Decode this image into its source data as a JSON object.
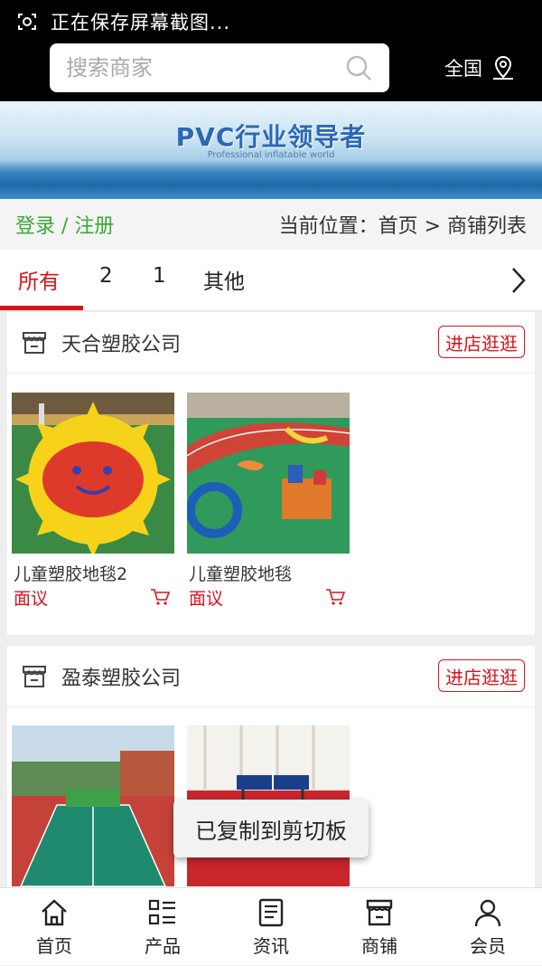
{
  "status_bar": {
    "message": "正在保存屏幕截图..."
  },
  "header": {
    "search": {
      "placeholder": "搜索商家",
      "value": ""
    },
    "region_label": "全国"
  },
  "banner": {
    "title": "PVC行业领导者",
    "subtitle": "Professional inflatable world"
  },
  "breadcrumb": {
    "login_label": "登录 / 注册",
    "position_label": "当前位置：首页 > 商铺列表"
  },
  "tabs": [
    {
      "label": "所有",
      "active": true
    },
    {
      "label": "2",
      "active": false
    },
    {
      "label": "1",
      "active": false
    },
    {
      "label": "其他",
      "active": false
    }
  ],
  "shops": [
    {
      "name": "天合塑胶公司",
      "visit_label": "进店逛逛",
      "products": [
        {
          "name": "儿童塑胶地毯2",
          "price": "面议"
        },
        {
          "name": "儿童塑胶地毯",
          "price": "面议"
        }
      ]
    },
    {
      "name": "盈泰塑胶公司",
      "visit_label": "进店逛逛",
      "products": []
    }
  ],
  "toast": {
    "message": "已复制到剪切板"
  },
  "bottom_nav": [
    {
      "label": "首页",
      "icon": "home-icon"
    },
    {
      "label": "产品",
      "icon": "product-list-icon"
    },
    {
      "label": "资讯",
      "icon": "news-icon"
    },
    {
      "label": "商铺",
      "icon": "shop-icon"
    },
    {
      "label": "会员",
      "icon": "member-icon"
    }
  ],
  "colors": {
    "accent": "#d6141b",
    "login": "#3aa935",
    "topbar": "#000000"
  }
}
